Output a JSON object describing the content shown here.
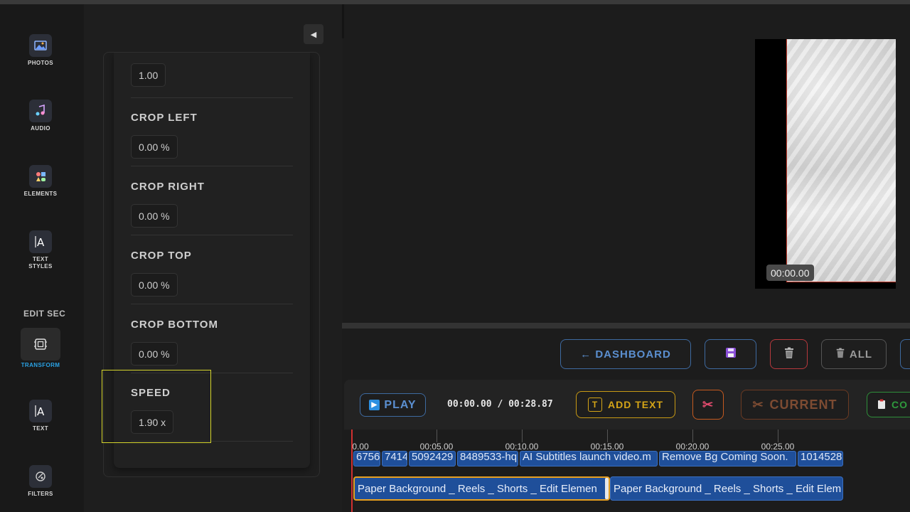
{
  "sidebar": {
    "items": [
      {
        "label": "PHOTOS",
        "icon": "photos-icon"
      },
      {
        "label": "AUDIO",
        "icon": "audio-icon"
      },
      {
        "label": "ELEMENTS",
        "icon": "elements-icon"
      },
      {
        "label": "TEXT STYLES",
        "icon": "text-styles-icon"
      },
      {
        "label": "TRANSFORM",
        "icon": "transform-icon"
      },
      {
        "label": "TEXT",
        "icon": "text-icon"
      },
      {
        "label": "FILTERS",
        "icon": "filters-icon"
      }
    ],
    "section_label": "EDIT SEC",
    "active_color": "#2aa3e6"
  },
  "panel": {
    "collapse_glyph": "◀",
    "opacity_value": "1.00",
    "crop_left": {
      "label": "CROP LEFT",
      "value": "0.00 %"
    },
    "crop_right": {
      "label": "CROP RIGHT",
      "value": "0.00 %"
    },
    "crop_top": {
      "label": "CROP TOP",
      "value": "0.00 %"
    },
    "crop_bottom": {
      "label": "CROP BOTTOM",
      "value": "0.00 %"
    },
    "speed": {
      "label": "SPEED",
      "value": "1.90 x"
    }
  },
  "preview": {
    "time": "00:00.00"
  },
  "toolbar": {
    "dashboard_label": "← DASHBOARD",
    "all_label": "ALL",
    "save_icon": "save-icon",
    "delete_icon": "trash-icon"
  },
  "timeline_controls": {
    "play_label": "PLAY",
    "timecode": "00:00.00 / 00:28.87",
    "add_text_label": "ADD TEXT",
    "current_label": "CURRENT",
    "copy_label": "CO"
  },
  "timeline": {
    "ticks": [
      "0.00",
      "00:05.00",
      "00:10.00",
      "00:15.00",
      "00:20.00",
      "00:25.00"
    ],
    "track1": [
      "6756",
      "7414",
      "5092429",
      "8489533-hq",
      "AI Subtitles launch video.m",
      "Remove Bg Coming Soon.",
      "1014528"
    ],
    "track2": [
      "Paper Background _ Reels _ Shorts _ Edit Elemen",
      "Paper Background _ Reels _ Shorts _ Edit Elem"
    ]
  },
  "colors": {
    "accent_blue": "#5b8fd0",
    "warning_red": "#b8393d",
    "yellow": "#d4a417",
    "green": "#2f9a3d",
    "highlight": "#d5d52c"
  }
}
